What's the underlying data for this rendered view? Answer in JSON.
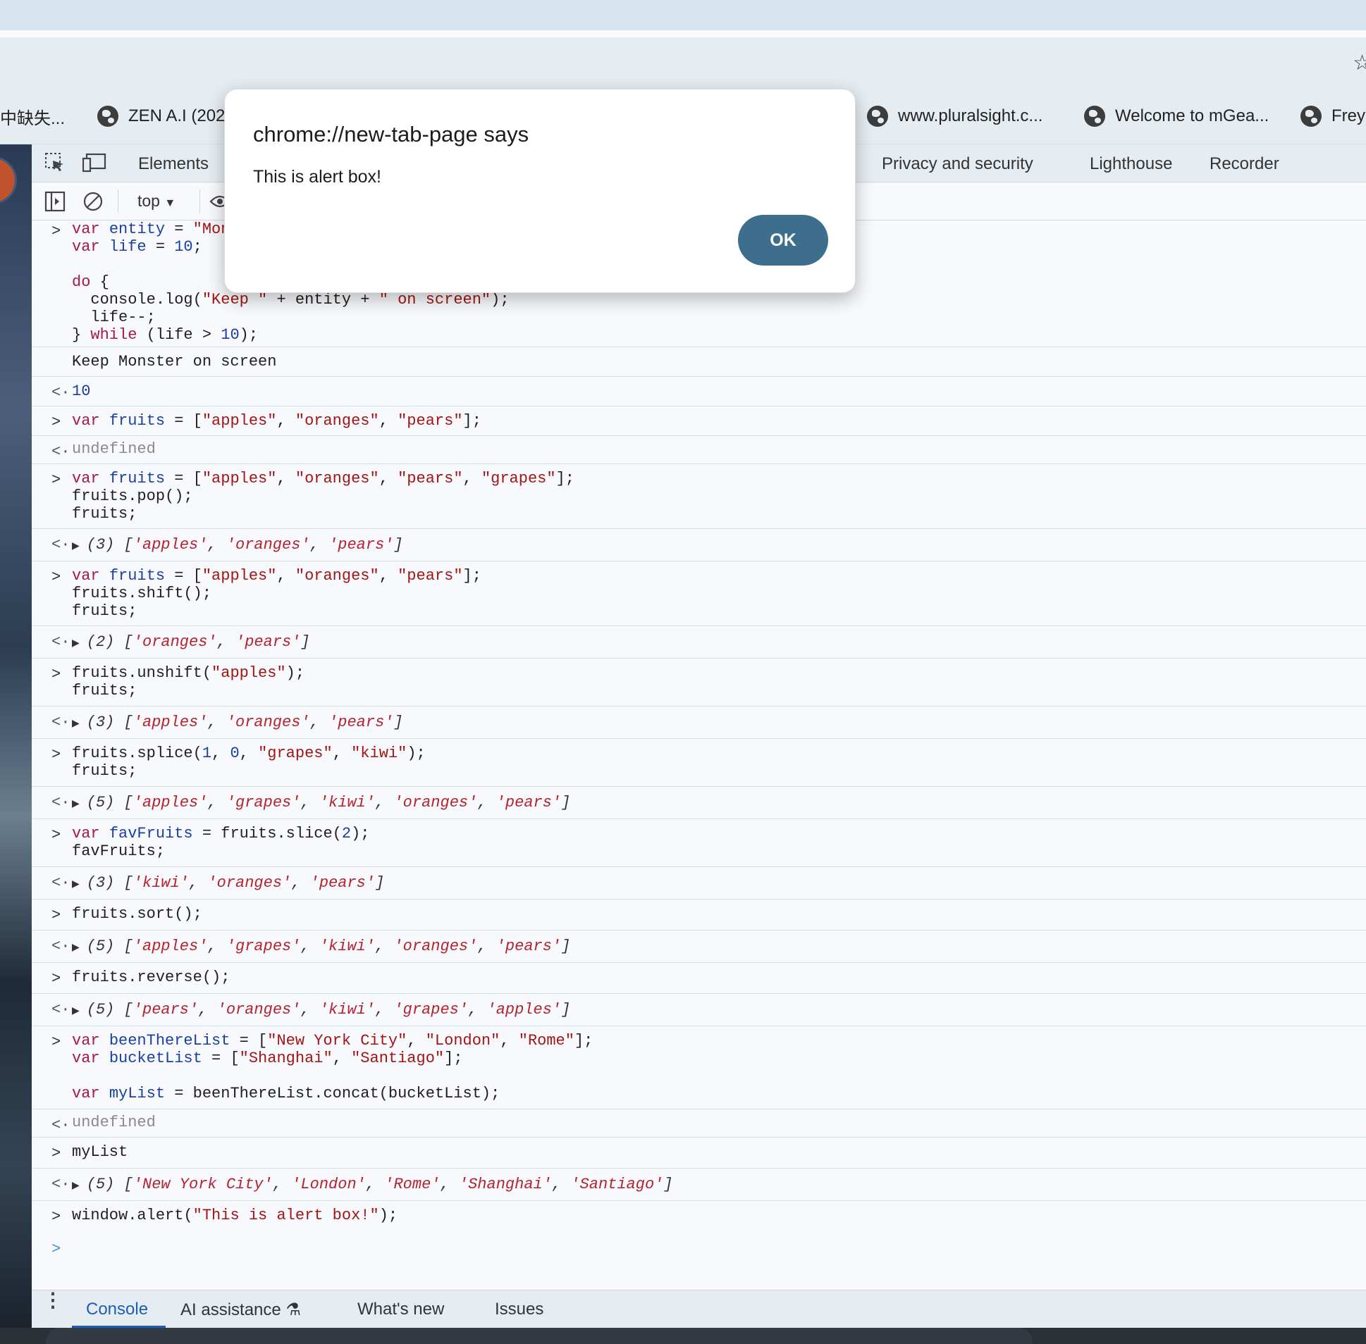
{
  "bookmarks": {
    "items": [
      {
        "label": "中缺失..."
      },
      {
        "label": "ZEN A.I (202"
      },
      {
        "label": "www.pluralsight.c..."
      },
      {
        "label": "Welcome to mGea..."
      },
      {
        "label": "Frey"
      }
    ]
  },
  "devtools": {
    "tabs": {
      "elements": "Elements",
      "privacy": "Privacy and security",
      "lighthouse": "Lighthouse",
      "recorder": "Recorder"
    },
    "toolbar": {
      "context": "top"
    },
    "bottom_tabs": {
      "console": "Console",
      "ai": "AI assistance",
      "whats_new": "What's new",
      "issues": "Issues"
    }
  },
  "console": {
    "e1_l1a": "var ",
    "e1_l1b": "entity",
    "e1_l1c": " = ",
    "e1_l1d": "\"Mon",
    "e1_l2a": "var ",
    "e1_l2b": "life",
    "e1_l2c": " = ",
    "e1_l2d": "10",
    "e1_l2e": ";",
    "e1_l4a": "do",
    "e1_l4b": " {",
    "e1_l5a": "  console.log(",
    "e1_l5b": "\"Keep \"",
    "e1_l5c": " + entity + ",
    "e1_l5d": "\" on screen\"",
    "e1_l5e": ");",
    "e1_l6": "  life--;",
    "e1_l7a": "} ",
    "e1_l7b": "while",
    "e1_l7c": " (life > ",
    "e1_l7d": "10",
    "e1_l7e": ");",
    "log1": "Keep Monster on screen",
    "r1": "10",
    "e2a": "var ",
    "e2b": "fruits",
    "e2c": " = [",
    "e2d": "\"apples\"",
    "e2e": ", ",
    "e2f": "\"oranges\"",
    "e2g": ", ",
    "e2h": "\"pears\"",
    "e2i": "];",
    "r2": "undefined",
    "e3_l1a": "var ",
    "e3_l1b": "fruits",
    "e3_l1c": " = [",
    "e3_l1d": "\"apples\"",
    "e3_l1e": ", ",
    "e3_l1f": "\"oranges\"",
    "e3_l1g": ", ",
    "e3_l1h": "\"pears\"",
    "e3_l1i": ", ",
    "e3_l1j": "\"grapes\"",
    "e3_l1k": "];",
    "e3_l2": "fruits.pop();",
    "e3_l3": "fruits;",
    "r3a": "(3) [",
    "r3b": "'apples'",
    "r3c": ", ",
    "r3d": "'oranges'",
    "r3e": ", ",
    "r3f": "'pears'",
    "r3g": "]",
    "e4_l1a": "var ",
    "e4_l1b": "fruits",
    "e4_l1c": " = [",
    "e4_l1d": "\"apples\"",
    "e4_l1e": ", ",
    "e4_l1f": "\"oranges\"",
    "e4_l1g": ", ",
    "e4_l1h": "\"pears\"",
    "e4_l1i": "];",
    "e4_l2": "fruits.shift();",
    "e4_l3": "fruits;",
    "r4a": "(2) [",
    "r4b": "'oranges'",
    "r4c": ", ",
    "r4d": "'pears'",
    "r4e": "]",
    "e5_l1a": "fruits.unshift(",
    "e5_l1b": "\"apples\"",
    "e5_l1c": ");",
    "e5_l2": "fruits;",
    "r5a": "(3) [",
    "r5b": "'apples'",
    "r5c": ", ",
    "r5d": "'oranges'",
    "r5e": ", ",
    "r5f": "'pears'",
    "r5g": "]",
    "e6_l1a": "fruits.splice(",
    "e6_l1b": "1",
    "e6_l1c": ", ",
    "e6_l1d": "0",
    "e6_l1e": ", ",
    "e6_l1f": "\"grapes\"",
    "e6_l1g": ", ",
    "e6_l1h": "\"kiwi\"",
    "e6_l1i": ");",
    "e6_l2": "fruits;",
    "r6a": "(5) [",
    "r6b": "'apples'",
    "r6c": ", ",
    "r6d": "'grapes'",
    "r6e": ", ",
    "r6f": "'kiwi'",
    "r6g": ", ",
    "r6h": "'oranges'",
    "r6i": ", ",
    "r6j": "'pears'",
    "r6k": "]",
    "e7_l1a": "var ",
    "e7_l1b": "favFruits",
    "e7_l1c": " = fruits.slice(",
    "e7_l1d": "2",
    "e7_l1e": ");",
    "e7_l2": "favFruits;",
    "r7a": "(3) [",
    "r7b": "'kiwi'",
    "r7c": ", ",
    "r7d": "'oranges'",
    "r7e": ", ",
    "r7f": "'pears'",
    "r7g": "]",
    "e8": "fruits.sort();",
    "r8a": "(5) [",
    "r8b": "'apples'",
    "r8c": ", ",
    "r8d": "'grapes'",
    "r8e": ", ",
    "r8f": "'kiwi'",
    "r8g": ", ",
    "r8h": "'oranges'",
    "r8i": ", ",
    "r8j": "'pears'",
    "r8k": "]",
    "e9": "fruits.reverse();",
    "r9a": "(5) [",
    "r9b": "'pears'",
    "r9c": ", ",
    "r9d": "'oranges'",
    "r9e": ", ",
    "r9f": "'kiwi'",
    "r9g": ", ",
    "r9h": "'grapes'",
    "r9i": ", ",
    "r9j": "'apples'",
    "r9k": "]",
    "e10_l1a": "var ",
    "e10_l1b": "beenThereList",
    "e10_l1c": " = [",
    "e10_l1d": "\"New York City\"",
    "e10_l1e": ", ",
    "e10_l1f": "\"London\"",
    "e10_l1g": ", ",
    "e10_l1h": "\"Rome\"",
    "e10_l1i": "];",
    "e10_l2a": "var ",
    "e10_l2b": "bucketList",
    "e10_l2c": " = [",
    "e10_l2d": "\"Shanghai\"",
    "e10_l2e": ", ",
    "e10_l2f": "\"Santiago\"",
    "e10_l2g": "];",
    "e10_l4a": "var ",
    "e10_l4b": "myList",
    "e10_l4c": " = beenThereList.concat(bucketList);",
    "r10": "undefined",
    "e11": "myList",
    "r11a": "(5) [",
    "r11b": "'New York City'",
    "r11c": ", ",
    "r11d": "'London'",
    "r11e": ", ",
    "r11f": "'Rome'",
    "r11g": ", ",
    "r11h": "'Shanghai'",
    "r11i": ", ",
    "r11j": "'Santiago'",
    "r11k": "]",
    "e12a": "window.alert(",
    "e12b": "\"This is alert box!\"",
    "e12c": ");"
  },
  "dialog": {
    "title": "chrome://new-tab-page says",
    "message": "This is alert box!",
    "ok": "OK"
  },
  "colors": {
    "accent": "#3d6e8d",
    "console_tab_active": "#1a5fb4"
  }
}
